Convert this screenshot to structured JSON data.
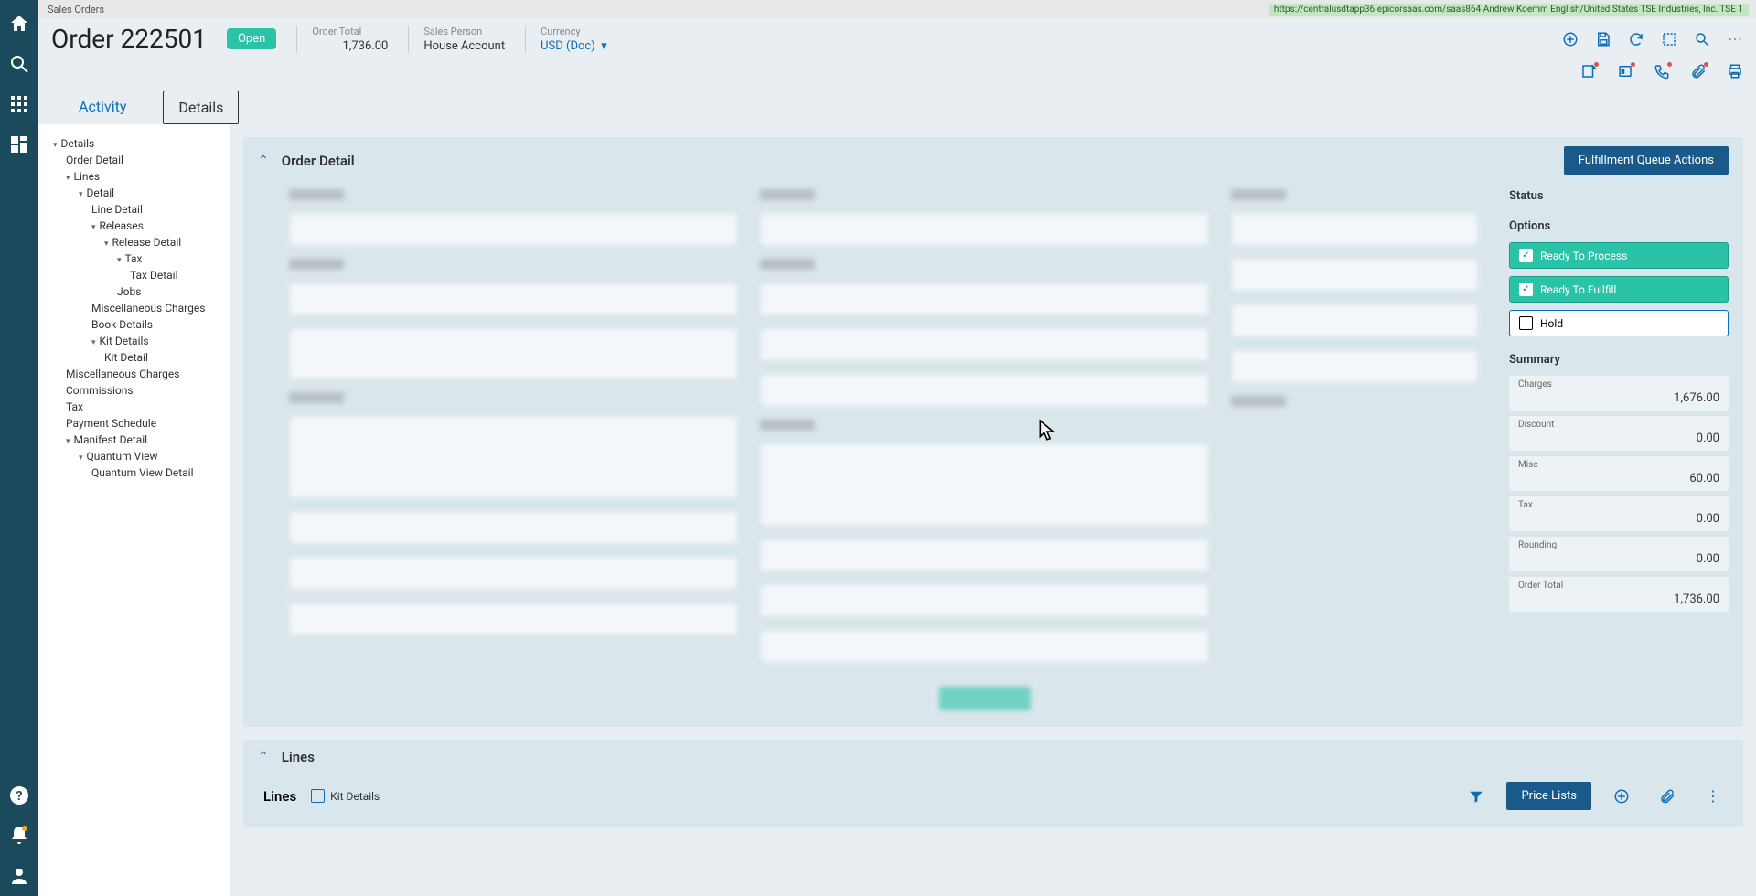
{
  "topbar": {
    "crumb": "Sales Orders",
    "env": "https://centralusdtapp36.epicorsaas.com/saas864   Andrew Koemm   English/United States   TSE Industries, Inc.   TSE 1"
  },
  "rail": {
    "home": "home-icon",
    "search": "search-icon",
    "apps": "apps-icon",
    "dashboard": "dashboard-icon",
    "help": "help-icon",
    "notif": "bell-icon",
    "user": "user-icon"
  },
  "header": {
    "title": "Order 222501",
    "status": "Open",
    "fields": {
      "order_total_lbl": "Order Total",
      "order_total": "1,736.00",
      "sales_person_lbl": "Sales Person",
      "sales_person": "House Account",
      "currency_lbl": "Currency",
      "currency": "USD (Doc)"
    }
  },
  "tabs": {
    "activity": "Activity",
    "details": "Details"
  },
  "tree": [
    {
      "l": 1,
      "caret": true,
      "t": "Details"
    },
    {
      "l": 2,
      "t": "Order Detail"
    },
    {
      "l": 2,
      "caret": true,
      "t": "Lines"
    },
    {
      "l": 3,
      "caret": true,
      "t": "Detail"
    },
    {
      "l": 4,
      "t": "Line Detail"
    },
    {
      "l": 4,
      "caret": true,
      "t": "Releases"
    },
    {
      "l": 5,
      "caret": true,
      "t": "Release Detail"
    },
    {
      "l": 6,
      "caret": true,
      "t": "Tax"
    },
    {
      "l": 7,
      "t": "Tax Detail"
    },
    {
      "l": 6,
      "t": "Jobs"
    },
    {
      "l": 4,
      "t": "Miscellaneous Charges"
    },
    {
      "l": 4,
      "t": "Book Details"
    },
    {
      "l": 4,
      "caret": true,
      "t": "Kit Details"
    },
    {
      "l": 5,
      "t": "Kit Detail"
    },
    {
      "l": 2,
      "t": "Miscellaneous Charges"
    },
    {
      "l": 2,
      "t": "Commissions"
    },
    {
      "l": 2,
      "t": "Tax"
    },
    {
      "l": 2,
      "t": "Payment Schedule"
    },
    {
      "l": 2,
      "caret": true,
      "t": "Manifest Detail"
    },
    {
      "l": 3,
      "caret": true,
      "t": "Quantum View"
    },
    {
      "l": 4,
      "t": "Quantum View Detail"
    }
  ],
  "detail_card": {
    "title": "Order Detail",
    "action_btn": "Fulfillment Queue Actions",
    "status_title": "Status",
    "options_title": "Options",
    "opt_ready_process": "Ready To Process",
    "opt_ready_fulfill": "Ready To Fullfill",
    "opt_hold": "Hold",
    "summary_title": "Summary",
    "summary": [
      {
        "label": "Charges",
        "value": "1,676.00"
      },
      {
        "label": "Discount",
        "value": "0.00"
      },
      {
        "label": "Misc",
        "value": "60.00"
      },
      {
        "label": "Tax",
        "value": "0.00"
      },
      {
        "label": "Rounding",
        "value": "0.00"
      },
      {
        "label": "Order Total",
        "value": "1,736.00"
      }
    ]
  },
  "lines_card": {
    "title": "Lines",
    "sub_title": "Lines",
    "kit_details": "Kit Details",
    "price_lists": "Price Lists"
  }
}
